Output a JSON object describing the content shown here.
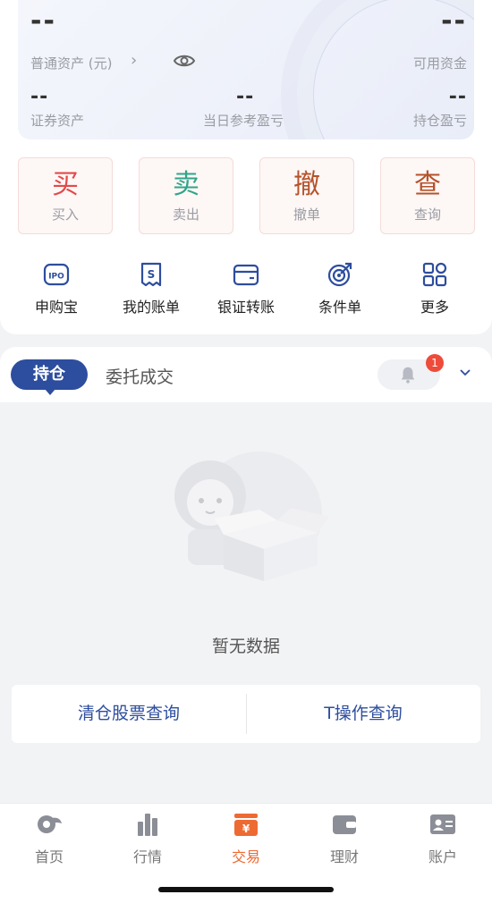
{
  "assets": {
    "total_value": "--",
    "total_label": "普通资产 (元)",
    "available_value": "--",
    "available_label": "可用资金",
    "securities_value": "--",
    "securities_label": "证券资产",
    "daily_pnl_value": "--",
    "daily_pnl_label": "当日参考盈亏",
    "holding_pnl_value": "--",
    "holding_pnl_label": "持仓盈亏"
  },
  "trade_buttons": [
    {
      "glyph": "买",
      "label": "买入",
      "color": "#e24a4a"
    },
    {
      "glyph": "卖",
      "label": "卖出",
      "color": "#2fa58a"
    },
    {
      "glyph": "撤",
      "label": "撤单",
      "color": "#b5532b"
    },
    {
      "glyph": "查",
      "label": "查询",
      "color": "#b5532b"
    }
  ],
  "quick_actions": [
    {
      "label": "申购宝",
      "icon": "ipo-icon"
    },
    {
      "label": "我的账单",
      "icon": "bill-icon"
    },
    {
      "label": "银证转账",
      "icon": "wallet-icon"
    },
    {
      "label": "条件单",
      "icon": "target-icon"
    },
    {
      "label": "更多",
      "icon": "grid-icon"
    }
  ],
  "tabs": {
    "active": "持仓",
    "other": "委托成交",
    "notification_count": "1"
  },
  "empty_state": {
    "text": "暂无数据"
  },
  "queries": {
    "left": "清仓股票查询",
    "right": "T操作查询"
  },
  "bottom_nav": [
    {
      "label": "首页",
      "icon": "home-icon"
    },
    {
      "label": "行情",
      "icon": "chart-icon"
    },
    {
      "label": "交易",
      "icon": "trade-icon",
      "active": true
    },
    {
      "label": "理财",
      "icon": "finance-icon"
    },
    {
      "label": "账户",
      "icon": "account-icon"
    }
  ],
  "colors": {
    "primary": "#2d4d9e",
    "active_nav": "#ee6a33",
    "badge": "#ee4b3a"
  }
}
